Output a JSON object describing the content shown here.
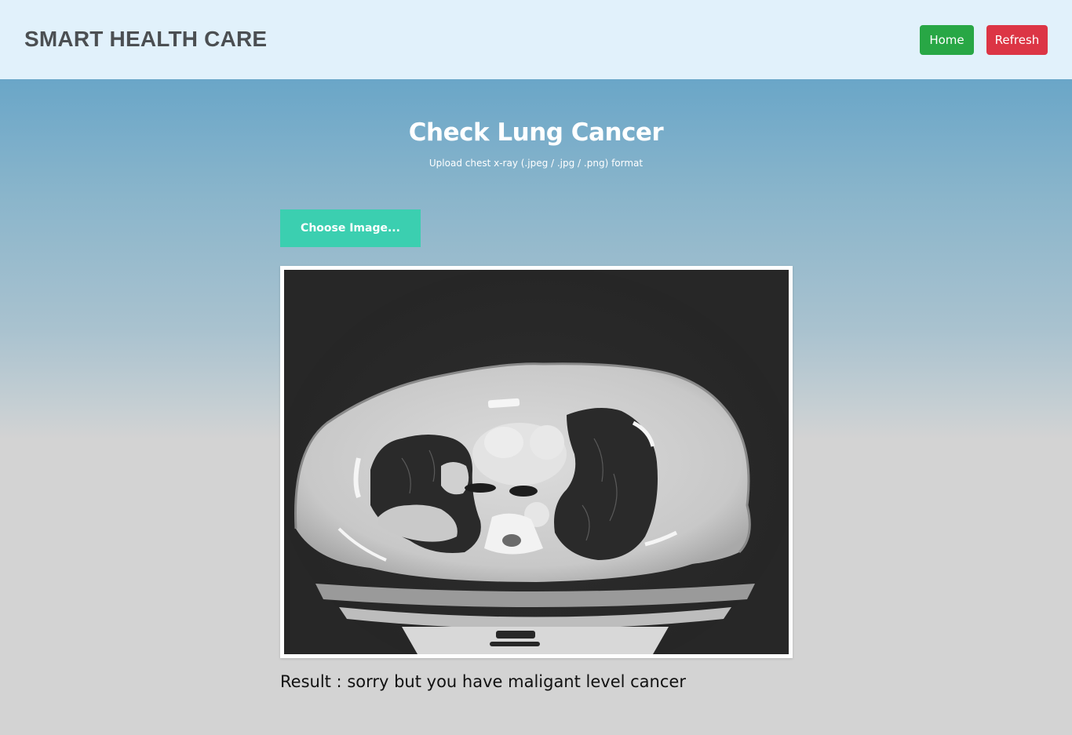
{
  "navbar": {
    "brand": "SMART HEALTH CARE",
    "home_label": "Home",
    "refresh_label": "Refresh"
  },
  "main": {
    "title": "Check Lung Cancer",
    "subtitle": "Upload chest x-ray (.jpeg / .jpg / .png) format",
    "choose_label": "Choose Image...",
    "result_text": "Result : sorry but you have maligant level cancer"
  },
  "colors": {
    "navbar_bg": "#e1f1fb",
    "home_button": "#28a745",
    "refresh_button": "#dc3545",
    "choose_button": "#3bcfb0",
    "page_gradient_top": "#67a5c8",
    "page_gradient_bottom": "#d3d3d3"
  },
  "uploaded_image": {
    "description_icon": "ct-scan-image"
  }
}
